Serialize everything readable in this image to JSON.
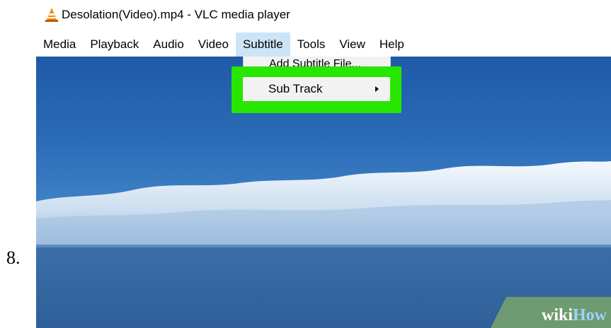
{
  "step_number": "8.",
  "window": {
    "title": "Desolation(Video).mp4 - VLC media player",
    "icon": "vlc-cone-icon"
  },
  "menubar": {
    "items": [
      {
        "label": "Media"
      },
      {
        "label": "Playback"
      },
      {
        "label": "Audio"
      },
      {
        "label": "Video"
      },
      {
        "label": "Subtitle",
        "active": true
      },
      {
        "label": "Tools"
      },
      {
        "label": "View"
      },
      {
        "label": "Help"
      }
    ]
  },
  "subtitle_menu": {
    "partially_hidden_item": "Add Subtitle File...",
    "highlighted_item": "Sub Track",
    "highlight_color": "#27e600"
  },
  "watermark": {
    "part1": "wiki",
    "part2": "How"
  },
  "colors": {
    "menu_active_bg": "#cce4f7",
    "menu_bg": "#f2f2f2"
  }
}
